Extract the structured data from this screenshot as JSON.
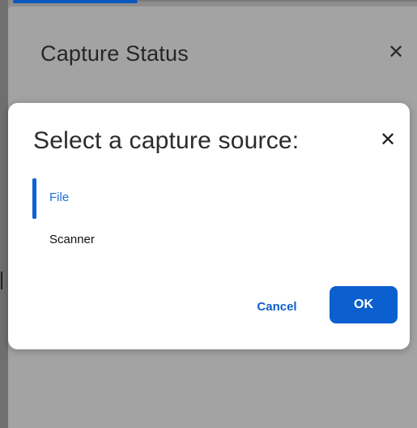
{
  "background_panel": {
    "title": "Capture Status",
    "close_glyph": "✕"
  },
  "dialog": {
    "title": "Select a capture source:",
    "close_glyph": "✕",
    "sources": [
      {
        "label": "File",
        "selected": true
      },
      {
        "label": "Scanner",
        "selected": false
      }
    ],
    "cancel_label": "Cancel",
    "ok_label": "OK"
  },
  "colors": {
    "accent": "#0b5fcf",
    "selected_text": "#1b6fd8",
    "overlay": "#8e8e8e"
  }
}
